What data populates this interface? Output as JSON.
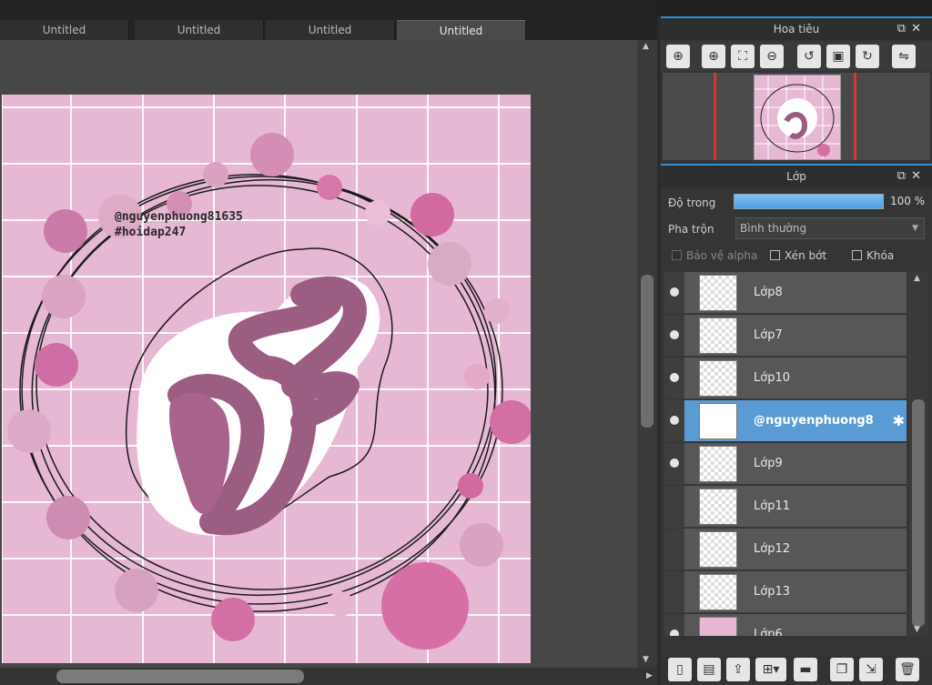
{
  "tabs": [
    {
      "label": "Untitled",
      "active": false
    },
    {
      "label": "Untitled",
      "active": false
    },
    {
      "label": "Untitled",
      "active": false
    },
    {
      "label": "Untitled",
      "active": true
    }
  ],
  "canvas": {
    "watermark_line1": "@nguyenphuong81635",
    "watermark_line2": "#hoidap247"
  },
  "navigator": {
    "title": "Hoa tiêu",
    "tools": [
      "zoom-fit-icon",
      "zoom-in-icon",
      "fit-screen-icon",
      "zoom-out-icon",
      "rotate-left-icon",
      "actual-size-icon",
      "rotate-right-icon",
      "flip-horizontal-icon"
    ]
  },
  "layers_panel": {
    "title": "Lớp",
    "opacity_label": "Độ trong",
    "opacity_value": "100 %",
    "opacity_fraction": 1.0,
    "blend_label": "Pha trộn",
    "blend_value": "Bình thường",
    "protect_alpha_label": "Bảo vệ alpha",
    "clip_label": "Xén bớt",
    "lock_label": "Khóa",
    "layers": [
      {
        "name": "Lớp8",
        "visible": true,
        "selected": false
      },
      {
        "name": "Lớp7",
        "visible": true,
        "selected": false
      },
      {
        "name": "Lớp10",
        "visible": true,
        "selected": false
      },
      {
        "name": "@nguyenphuong8",
        "visible": true,
        "selected": true
      },
      {
        "name": "Lớp9",
        "visible": true,
        "selected": false
      },
      {
        "name": "Lớp11",
        "visible": false,
        "selected": false
      },
      {
        "name": "Lớp12",
        "visible": false,
        "selected": false
      },
      {
        "name": "Lớp13",
        "visible": false,
        "selected": false
      },
      {
        "name": "Lớp6",
        "visible": true,
        "selected": false
      }
    ],
    "toolbar": [
      "new-layer-icon",
      "new-layer-from-file-icon",
      "import-layer-icon",
      "new-layer-dropdown-icon",
      "new-folder-icon",
      "duplicate-layer-icon",
      "merge-layer-icon",
      "delete-layer-icon"
    ]
  },
  "colors": {
    "accent": "#2f8fd8",
    "artboard_bg": "#e7b8d3",
    "selected_layer": "#5b9bd4"
  }
}
